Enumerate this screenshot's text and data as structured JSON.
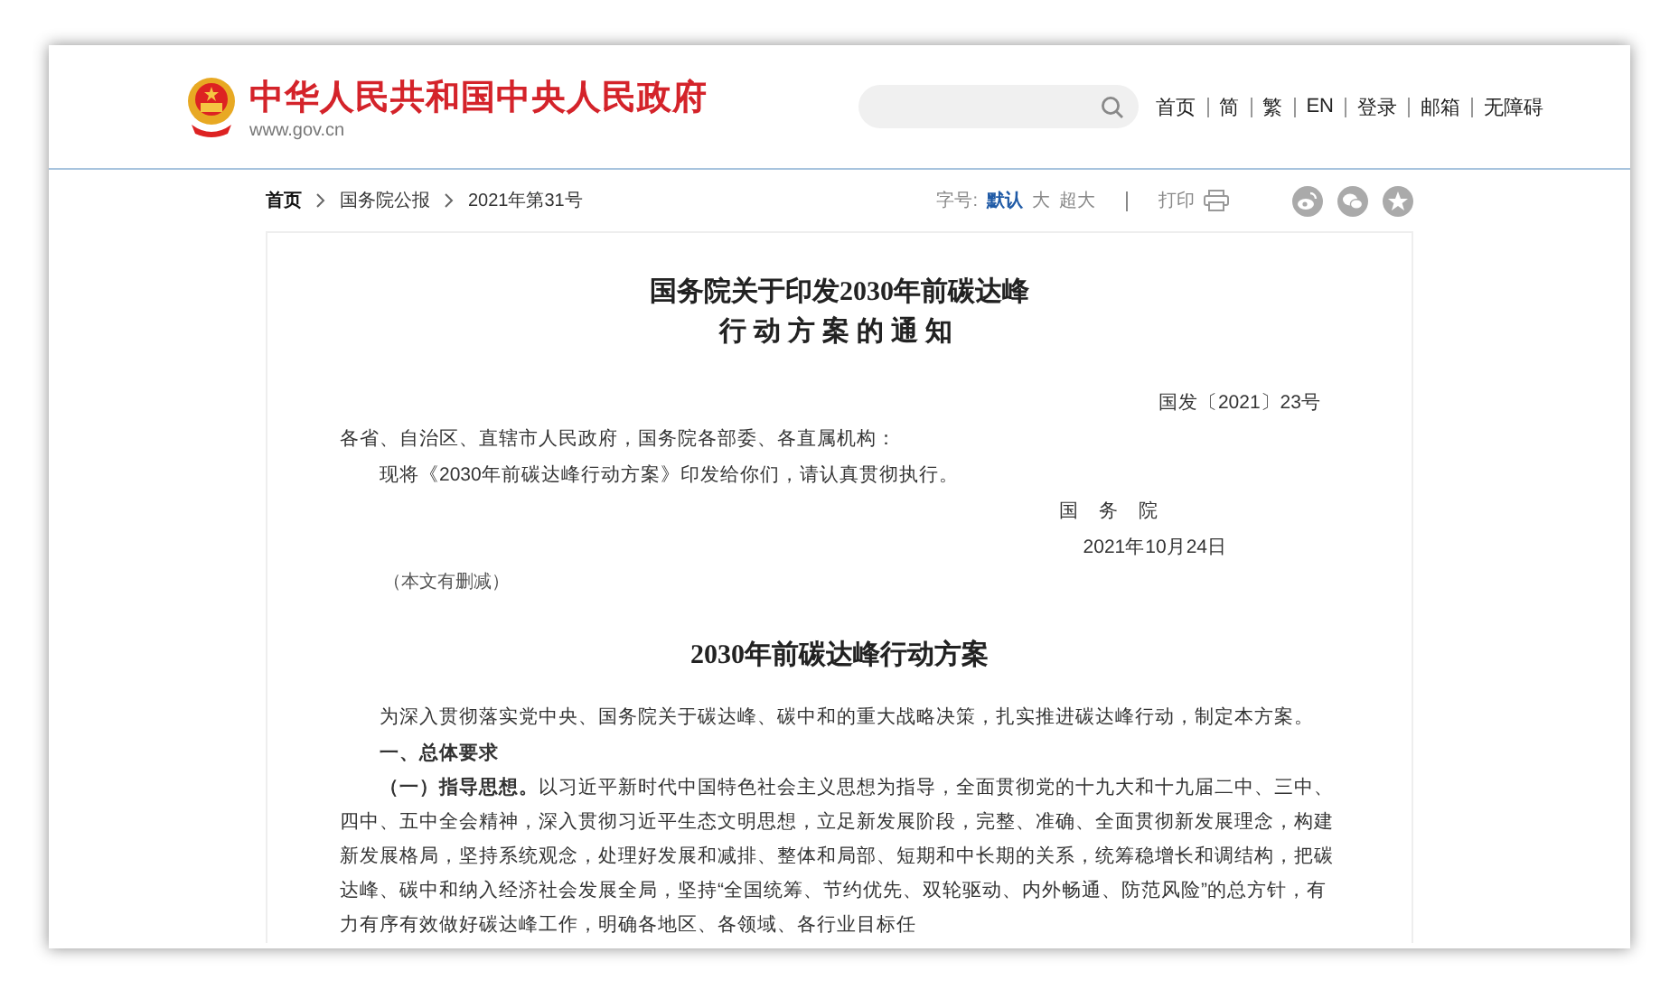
{
  "header": {
    "site_name": "中华人民共和国中央人民政府",
    "site_url": "www.gov.cn",
    "nav_links": [
      "首页",
      "简",
      "繁",
      "EN",
      "登录",
      "邮箱",
      "无障碍"
    ]
  },
  "breadcrumb": [
    "首页",
    "国务院公报",
    "2021年第31号"
  ],
  "toolbar": {
    "font_size_label": "字号:",
    "font_sizes": [
      {
        "label": "默认",
        "selected": true
      },
      {
        "label": "大",
        "selected": false
      },
      {
        "label": "超大",
        "selected": false
      }
    ],
    "print_label": "打印"
  },
  "document": {
    "title_lines": [
      "国务院关于印发2030年前碳达峰",
      "行动方案的通知"
    ],
    "doc_number": "国发〔2021〕23号",
    "salutation": "各省、自治区、直辖市人民政府，国务院各部委、各直属机构：",
    "body": "现将《2030年前碳达峰行动方案》印发给你们，请认真贯彻执行。",
    "issuer": "国　务　院",
    "date": "2021年10月24日",
    "note": "（本文有删减）",
    "plan_title": "2030年前碳达峰行动方案",
    "intro": "为深入贯彻落实党中央、国务院关于碳达峰、碳中和的重大战略决策，扎实推进碳达峰行动，制定本方案。",
    "section_heading": "一、总体要求",
    "paragraph_label": "（一）指导思想。",
    "paragraph": "以习近平新时代中国特色社会主义思想为指导，全面贯彻党的十九大和十九届二中、三中、四中、五中全会精神，深入贯彻习近平生态文明思想，立足新发展阶段，完整、准确、全面贯彻新发展理念，构建新发展格局，坚持系统观念，处理好发展和减排、整体和局部、短期和中长期的关系，统筹稳增长和调结构，把碳达峰、碳中和纳入经济社会发展全局，坚持“全国统筹、节约优先、双轮驱动、内外畅通、防范风险”的总方针，有力有序有效做好碳达峰工作，明确各地区、各领域、各行业目标任"
  }
}
